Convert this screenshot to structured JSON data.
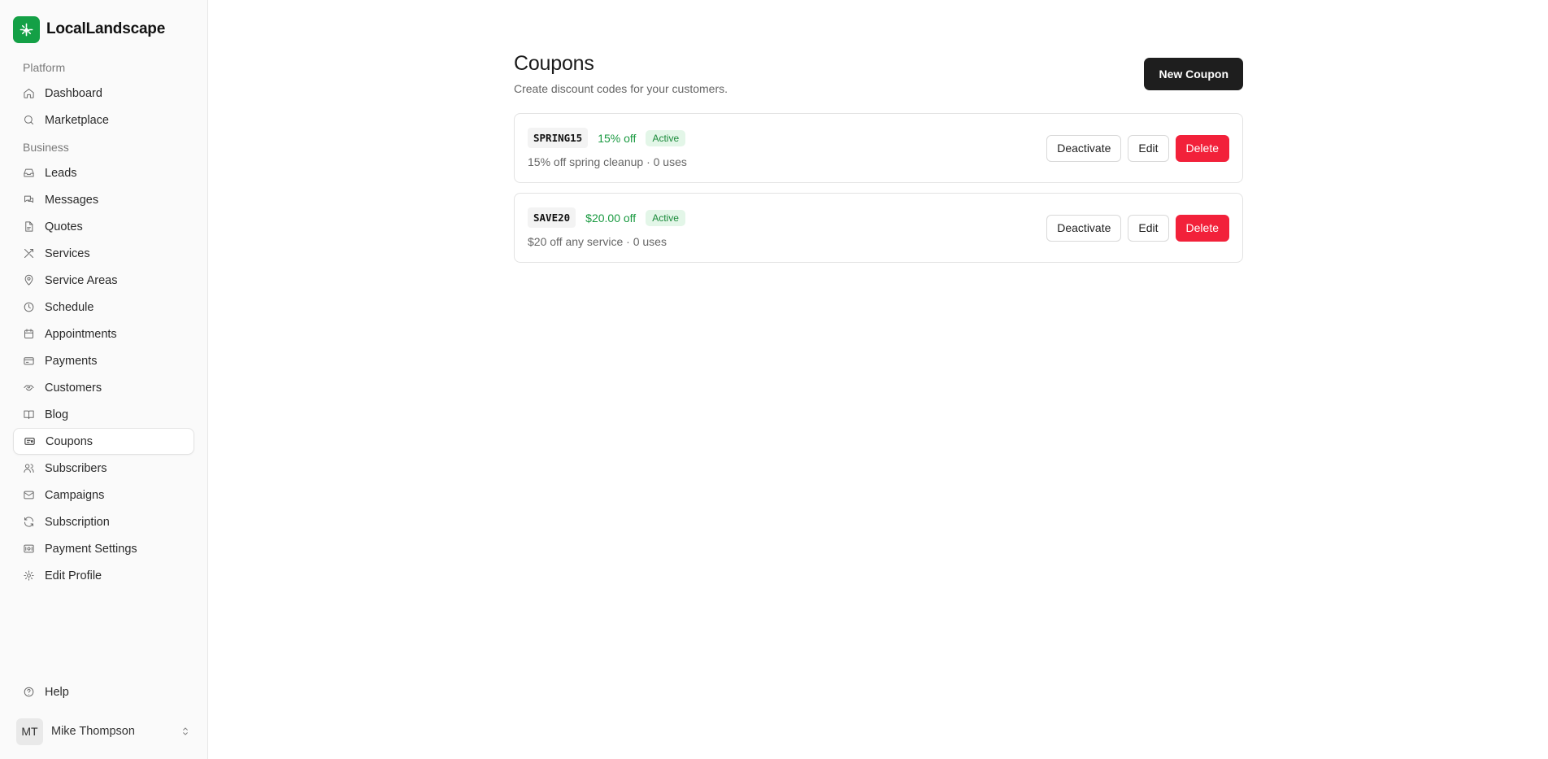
{
  "brand": {
    "name": "LocalLandscape",
    "color": "#14a046"
  },
  "sidebar": {
    "sections": [
      {
        "label": "Platform",
        "items": [
          {
            "label": "Dashboard",
            "icon": "home-icon"
          },
          {
            "label": "Marketplace",
            "icon": "search-icon"
          }
        ]
      },
      {
        "label": "Business",
        "items": [
          {
            "label": "Leads",
            "icon": "inbox-icon"
          },
          {
            "label": "Messages",
            "icon": "messages-icon"
          },
          {
            "label": "Quotes",
            "icon": "file-icon"
          },
          {
            "label": "Services",
            "icon": "tools-icon"
          },
          {
            "label": "Service Areas",
            "icon": "map-pin-icon"
          },
          {
            "label": "Schedule",
            "icon": "clock-icon"
          },
          {
            "label": "Appointments",
            "icon": "calendar-icon"
          },
          {
            "label": "Payments",
            "icon": "credit-card-icon"
          },
          {
            "label": "Customers",
            "icon": "handshake-icon"
          },
          {
            "label": "Blog",
            "icon": "book-icon"
          },
          {
            "label": "Coupons",
            "icon": "ticket-icon",
            "active": true
          },
          {
            "label": "Subscribers",
            "icon": "users-icon"
          },
          {
            "label": "Campaigns",
            "icon": "mail-icon"
          },
          {
            "label": "Subscription",
            "icon": "refresh-icon"
          },
          {
            "label": "Payment Settings",
            "icon": "wallet-icon"
          },
          {
            "label": "Edit Profile",
            "icon": "gear-icon"
          }
        ]
      }
    ],
    "help": "Help",
    "user": {
      "initials": "MT",
      "name": "Mike Thompson"
    }
  },
  "page": {
    "title": "Coupons",
    "subtitle": "Create discount codes for your customers.",
    "new_button": "New Coupon"
  },
  "coupons": [
    {
      "code": "SPRING15",
      "discount": "15% off",
      "status": "Active",
      "description": "15% off spring cleanup · 0 uses",
      "actions": {
        "deactivate": "Deactivate",
        "edit": "Edit",
        "delete": "Delete"
      }
    },
    {
      "code": "SAVE20",
      "discount": "$20.00 off",
      "status": "Active",
      "description": "$20 off any service · 0 uses",
      "actions": {
        "deactivate": "Deactivate",
        "edit": "Edit",
        "delete": "Delete"
      }
    }
  ],
  "colors": {
    "primary_button": "#1e1e1e",
    "danger": "#f2213a",
    "success": "#1a9a41",
    "badge_bg": "#e3f6e8"
  }
}
